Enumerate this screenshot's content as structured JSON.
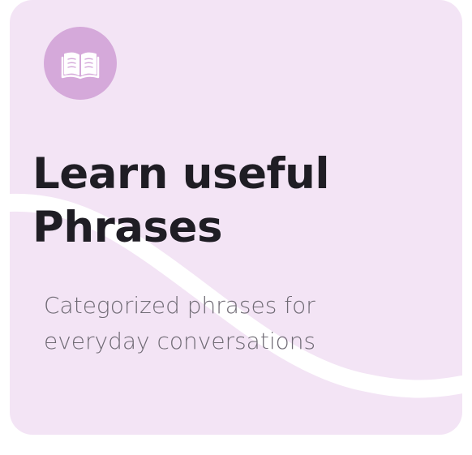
{
  "card": {
    "title": "Learn useful\nPhrases",
    "subtitle": "Categorized phrases for\neveryday conversations",
    "icon": "open-book-icon"
  },
  "colors": {
    "card_background": "#f3e4f5",
    "icon_circle": "#d5a9da",
    "wave": "#ffffff",
    "title_text": "#1f1d24",
    "subtitle_text": "#6f6a74"
  }
}
